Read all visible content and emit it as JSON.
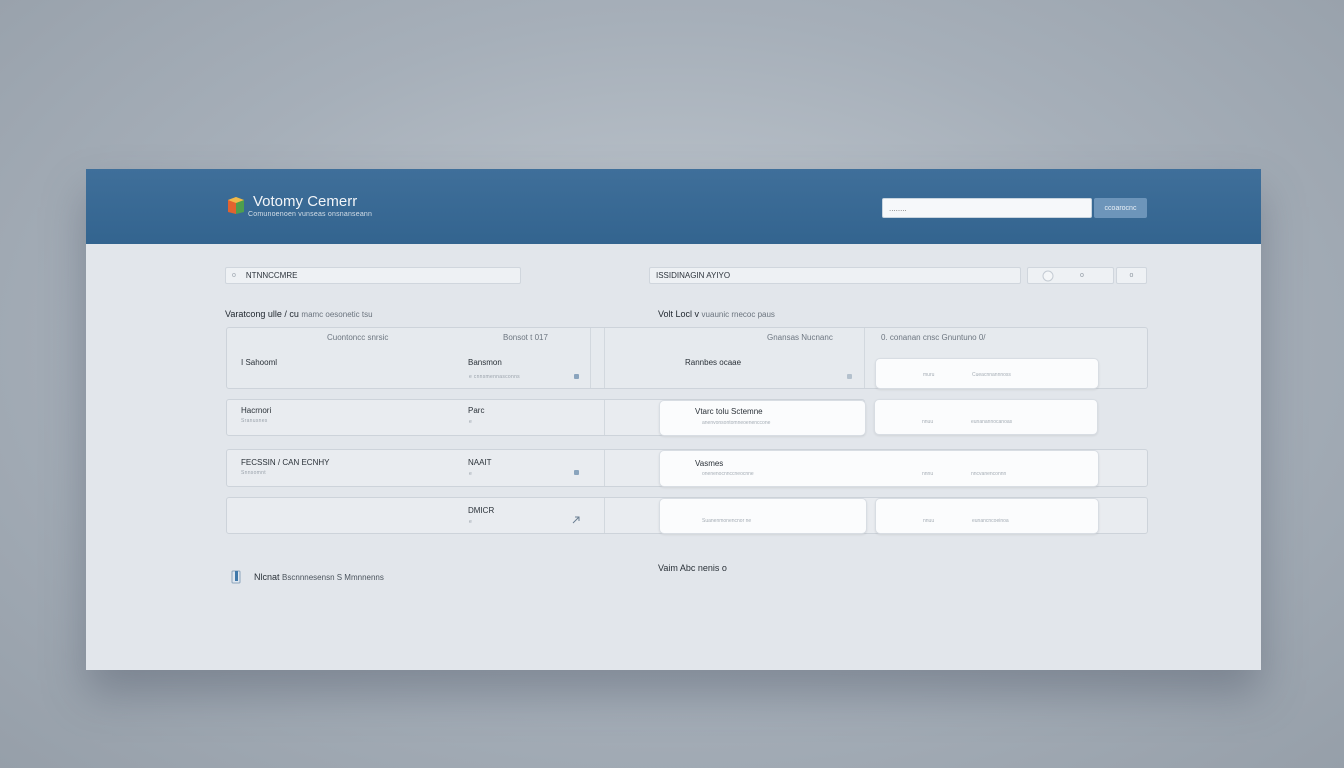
{
  "header": {
    "app_title": "Votomy Cemerr",
    "app_subtitle": "Comunoenoen vunseas onsnanseann",
    "search_placeholder": "........",
    "search_button": "ccoarocnc"
  },
  "filters": {
    "left_prefix": "o",
    "left_label": "NTNNCCMRE",
    "middle_label": "ISSIDINAGIN AYIYO",
    "right_value": "o",
    "right_badge": "o"
  },
  "sections": {
    "left_title": "Varatcong ulle / cu",
    "left_meta": "mamc oesonetic tsu",
    "right_title": "Volt Locl v",
    "right_meta": "vuaunic rnecoc paus"
  },
  "table": {
    "columns": [
      "Cuontoncc snrsic",
      "Bonsot t 017",
      "Gnansas Nucnanc",
      "0. conanan cnsc Gnuntuno 0/"
    ],
    "rows": [
      {
        "c1_title": "I Sahooml",
        "c1_sub": "",
        "c2_title": "Bansmon",
        "c2_sub": "e cnnsmennasconns",
        "c3_title": "Rannbes ocaae",
        "card_lines": [
          "muru",
          "Cueacnnannnoss"
        ]
      },
      {
        "c1_title": "Hacrnori",
        "c1_sub": "Sranusnes",
        "c2_title": "Parc",
        "c2_sub": "e",
        "c3_title": "Vtarc tolu Sctemne",
        "c3_sub": "anenvonsontomneoenenccone",
        "card_lines": [
          "nnuu",
          "eunanannocanoas"
        ]
      },
      {
        "c1_title": "FECSSIN / CAN ECNHY",
        "c1_sub": "Snnsomnt",
        "c2_title": "NAAIT",
        "c2_sub": "e",
        "c3_title": "Vasmes",
        "c3_sub": "onenenocnnccneocnne",
        "card_lines": [
          "nnnu",
          "nncvanenconnn"
        ]
      },
      {
        "c1_title": "",
        "c1_sub": "",
        "c2_title": "DMICR",
        "c2_sub": "e",
        "c3_sub": "Suanenmonencnor ne",
        "card_lines": [
          "nnuu",
          "eunancncoeinoa"
        ]
      }
    ]
  },
  "footer": {
    "status_label": "Nlcnat",
    "status_text": "Bscnnnesensn S Mmnnenns",
    "center_text": "Vaim Abc nenis o"
  },
  "colors": {
    "header_bg": "#3a6a95",
    "accent_button": "#6d95ba",
    "panel_bg": "#e2e6eb"
  }
}
